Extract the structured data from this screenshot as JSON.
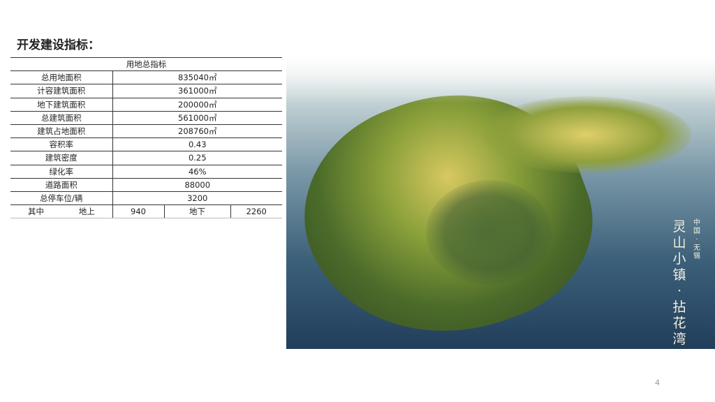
{
  "title": "开发建设指标：",
  "table": {
    "header": "用地总指标",
    "rows": [
      {
        "label": "总用地面积",
        "value": "835040㎡"
      },
      {
        "label": "计容建筑面积",
        "value": "361000㎡"
      },
      {
        "label": "地下建筑面积",
        "value": "200000㎡"
      },
      {
        "label": "总建筑面积",
        "value": "561000㎡"
      },
      {
        "label": "建筑占地面积",
        "value": "208760㎡"
      },
      {
        "label": "容积率",
        "value": "0.43"
      },
      {
        "label": "建筑密度",
        "value": "0.25"
      },
      {
        "label": "绿化率",
        "value": "46%"
      },
      {
        "label": "道路面积",
        "value": "88000"
      },
      {
        "label": "总停车位/辆",
        "value": "3200"
      }
    ],
    "last_row": [
      "其中",
      "地上",
      "940",
      "地下",
      "2260"
    ]
  },
  "image": {
    "caption_main": "灵山小镇·拈花湾",
    "caption_sub": "中国·无锡"
  },
  "page_number": "4"
}
